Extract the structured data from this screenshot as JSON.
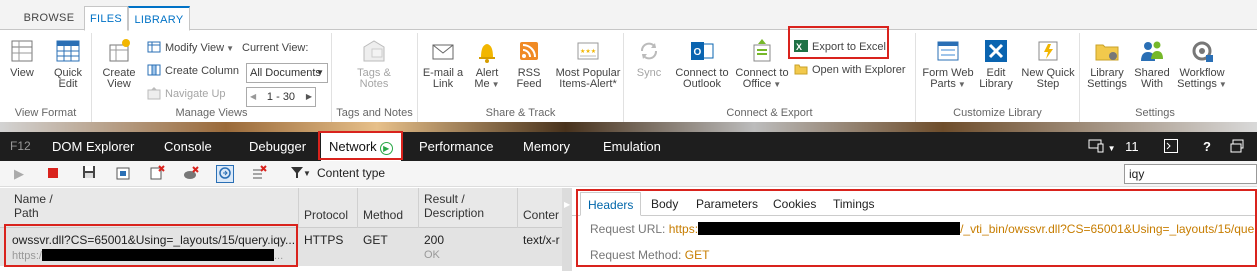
{
  "ribbon": {
    "tabs": [
      {
        "label": "BROWSE"
      },
      {
        "label": "FILES"
      },
      {
        "label": "LIBRARY"
      }
    ],
    "groups": {
      "view_format": {
        "label": "View Format",
        "view": "View",
        "quick_edit_1": "Quick",
        "quick_edit_2": "Edit"
      },
      "manage_views": {
        "label": "Manage Views",
        "create_view_1": "Create",
        "create_view_2": "View",
        "modify_view": "Modify View",
        "create_column": "Create Column",
        "navigate_up": "Navigate Up",
        "current_view_label": "Current View:",
        "current_view_value": "All Documents",
        "pager": "1 - 30"
      },
      "tags_notes": {
        "label": "Tags and Notes",
        "tags_1": "Tags &",
        "tags_2": "Notes"
      },
      "share_track": {
        "label": "Share & Track",
        "email_1": "E-mail a",
        "email_2": "Link",
        "alert_1": "Alert",
        "alert_2": "Me",
        "rss_1": "RSS",
        "rss_2": "Feed",
        "popular_1": "Most Popular",
        "popular_2": "Items-Alert*"
      },
      "connect_export": {
        "label": "Connect & Export",
        "sync": "Sync",
        "outlook_1": "Connect to",
        "outlook_2": "Outlook",
        "office_1": "Connect to",
        "office_2": "Office",
        "export_excel": "Export to Excel",
        "open_explorer": "Open with Explorer"
      },
      "customize": {
        "label": "Customize Library",
        "form_1": "Form Web",
        "form_2": "Parts",
        "edit_1": "Edit",
        "edit_2": "Library",
        "newquick_1": "New Quick",
        "newquick_2": "Step"
      },
      "settings": {
        "label": "Settings",
        "lib_1": "Library",
        "lib_2": "Settings",
        "shared_1": "Shared",
        "shared_2": "With",
        "workflow_1": "Workflow",
        "workflow_2": "Settings"
      }
    }
  },
  "devtools": {
    "f12": "F12",
    "tabs": [
      {
        "label": "DOM Explorer"
      },
      {
        "label": "Console"
      },
      {
        "label": "Debugger"
      },
      {
        "label": "Network"
      },
      {
        "label": "Performance"
      },
      {
        "label": "Memory"
      },
      {
        "label": "Emulation"
      }
    ],
    "browser_version": "11",
    "help": "?",
    "toolbar": {
      "content_type": "Content type",
      "search_value": "iqy"
    },
    "table": {
      "headers": {
        "name_1": "Name /",
        "name_2": "Path",
        "protocol": "Protocol",
        "method": "Method",
        "result_1": "Result /",
        "result_2": "Description",
        "content": "Conter"
      },
      "row": {
        "name": "owssvr.dll?CS=65001&Using=_layouts/15/query.iqy...",
        "path_prefix": "https:/",
        "protocol": "HTTPS",
        "method": "GET",
        "result": "200",
        "description": "OK",
        "content": "text/x-r"
      }
    },
    "details": {
      "tabs": [
        {
          "label": "Headers"
        },
        {
          "label": "Body"
        },
        {
          "label": "Parameters"
        },
        {
          "label": "Cookies"
        },
        {
          "label": "Timings"
        }
      ],
      "request_url_key": "Request URL:",
      "request_url_prefix": "https:",
      "request_url_suffix": "/_vti_bin/owssvr.dll?CS=65001&Using=_layouts/15/que...",
      "request_method_key": "Request Method:",
      "request_method_value": "GET"
    }
  },
  "colors": {
    "accent": "#0072c6",
    "highlight_box": "#d9231d",
    "dev_bar": "#1e1e1e",
    "value_orange": "#c77d00"
  }
}
